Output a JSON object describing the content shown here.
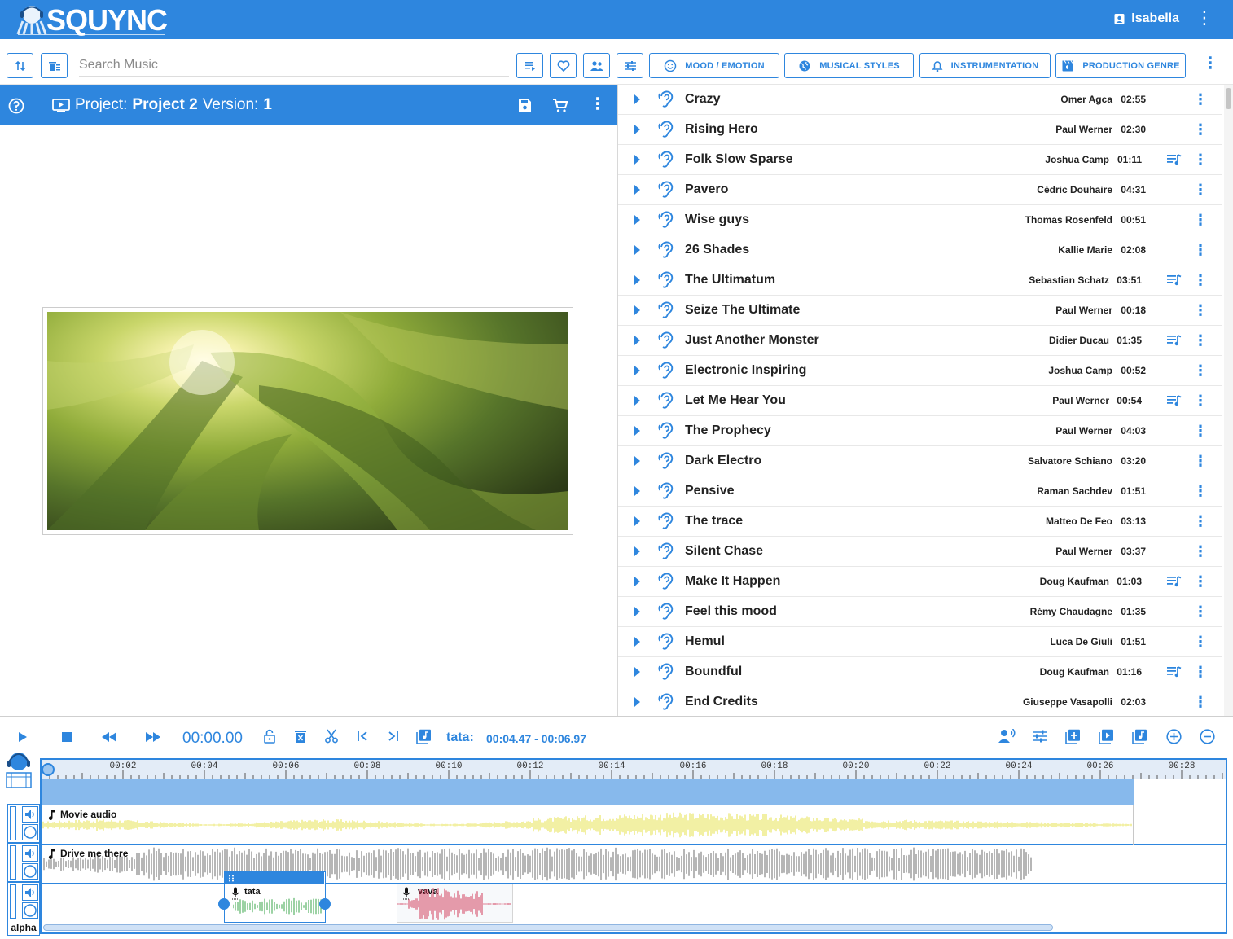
{
  "app": {
    "logo": "SQUYNC",
    "user": "Isabella"
  },
  "toolbar": {
    "search_placeholder": "Search Music",
    "mood_label": "MOOD / EMOTION",
    "styles_label": "MUSICAL STYLES",
    "instrumentation_label": "INSTRUMENTATION",
    "genre_label": "PRODUCTION GENRE"
  },
  "project": {
    "prefix": "Project:",
    "name": "Project 2",
    "version_label": "Version:",
    "version": "1"
  },
  "tracks": [
    {
      "title": "Crazy",
      "artist": "Omer Agca",
      "duration": "02:55",
      "playlist": false
    },
    {
      "title": "Rising Hero",
      "artist": "Paul Werner",
      "duration": "02:30",
      "playlist": false
    },
    {
      "title": "Folk Slow Sparse",
      "artist": "Joshua Camp",
      "duration": "01:11",
      "playlist": true
    },
    {
      "title": "Pavero",
      "artist": "Cédric Douhaire",
      "duration": "04:31",
      "playlist": false
    },
    {
      "title": "Wise guys",
      "artist": "Thomas Rosenfeld",
      "duration": "00:51",
      "playlist": false
    },
    {
      "title": "26 Shades",
      "artist": "Kallie Marie",
      "duration": "02:08",
      "playlist": false
    },
    {
      "title": "The Ultimatum",
      "artist": "Sebastian Schatz",
      "duration": "03:51",
      "playlist": true
    },
    {
      "title": "Seize The Ultimate",
      "artist": "Paul Werner",
      "duration": "00:18",
      "playlist": false
    },
    {
      "title": "Just Another Monster",
      "artist": "Didier Ducau",
      "duration": "01:35",
      "playlist": true
    },
    {
      "title": "Electronic Inspiring",
      "artist": "Joshua Camp",
      "duration": "00:52",
      "playlist": false
    },
    {
      "title": "Let Me Hear You",
      "artist": "Paul Werner",
      "duration": "00:54",
      "playlist": true
    },
    {
      "title": "The Prophecy",
      "artist": "Paul Werner",
      "duration": "04:03",
      "playlist": false
    },
    {
      "title": "Dark Electro",
      "artist": "Salvatore Schiano",
      "duration": "03:20",
      "playlist": false
    },
    {
      "title": "Pensive",
      "artist": "Raman Sachdev",
      "duration": "01:51",
      "playlist": false
    },
    {
      "title": "The trace",
      "artist": "Matteo De Feo",
      "duration": "03:13",
      "playlist": false
    },
    {
      "title": "Silent Chase",
      "artist": "Paul Werner",
      "duration": "03:37",
      "playlist": false
    },
    {
      "title": "Make It Happen",
      "artist": "Doug Kaufman",
      "duration": "01:03",
      "playlist": true
    },
    {
      "title": "Feel this mood",
      "artist": "Rémy Chaudagne",
      "duration": "01:35",
      "playlist": false
    },
    {
      "title": "Hemul",
      "artist": "Luca De Giuli",
      "duration": "01:51",
      "playlist": false
    },
    {
      "title": "Boundful",
      "artist": "Doug Kaufman",
      "duration": "01:16",
      "playlist": true
    },
    {
      "title": "End Credits",
      "artist": "Giuseppe Vasapolli",
      "duration": "02:03",
      "playlist": false
    }
  ],
  "transport": {
    "timecode": "00:00.00",
    "clip_name": "tata:",
    "clip_range": "00:04.47 - 00:06.97"
  },
  "timeline": {
    "ticks": [
      "00:02",
      "00:04",
      "00:06",
      "00:08",
      "00:10",
      "00:12",
      "00:14",
      "00:16",
      "00:18",
      "00:20",
      "00:22",
      "00:24",
      "00:26",
      "00:28"
    ],
    "track1_name": "Movie audio",
    "track2_name": "Drive me there",
    "clip1_name": "tata",
    "clip2_name": "vava",
    "lane_label": "alpha",
    "colors": {
      "movie_wave": "#e6e04a",
      "drive_wave": "#6e6e6e",
      "tata_wave": "#3aa64a",
      "vava_wave": "#d23a5a"
    }
  }
}
